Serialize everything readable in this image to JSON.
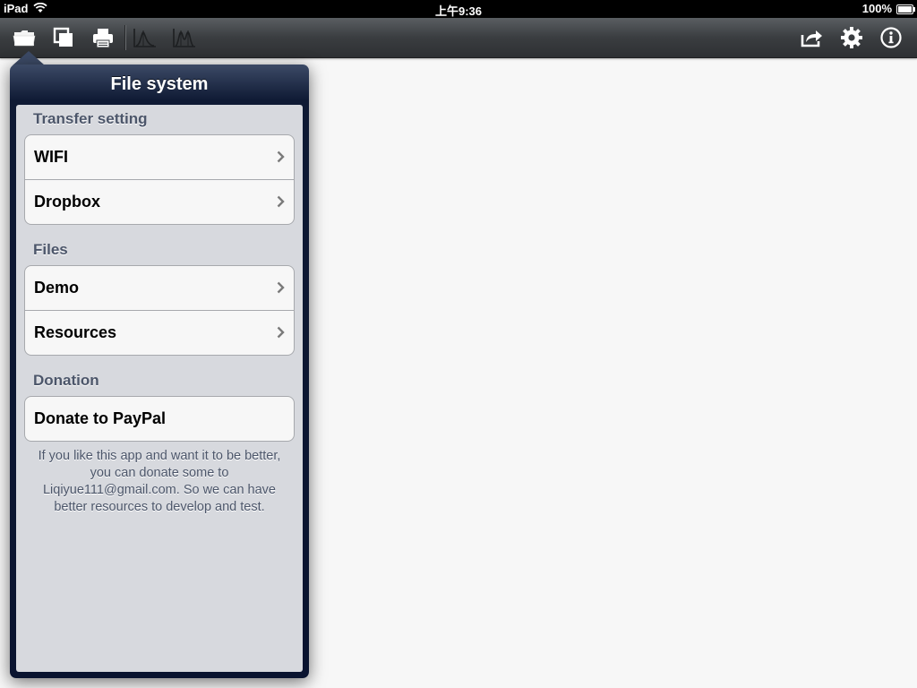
{
  "status_bar": {
    "carrier": "iPad",
    "time": "上午9:36",
    "battery": "100%"
  },
  "toolbar": {
    "left_icons": [
      "folder-icon",
      "copy-icon",
      "print-icon",
      "peak-chart-icon",
      "multi-peak-chart-icon"
    ],
    "right_icons": [
      "share-icon",
      "gear-icon",
      "info-icon"
    ]
  },
  "popover": {
    "title": "File system",
    "sections": [
      {
        "header": "Transfer setting",
        "items": [
          "WIFI",
          "Dropbox"
        ]
      },
      {
        "header": "Files",
        "items": [
          "Demo",
          "Resources"
        ]
      },
      {
        "header": "Donation",
        "items": [
          "Donate to PayPal"
        ]
      }
    ],
    "footer": "If you like this app and want it to be better, you can donate some to Liqiyue111@gmail.com. So we can have better resources to develop and test."
  }
}
